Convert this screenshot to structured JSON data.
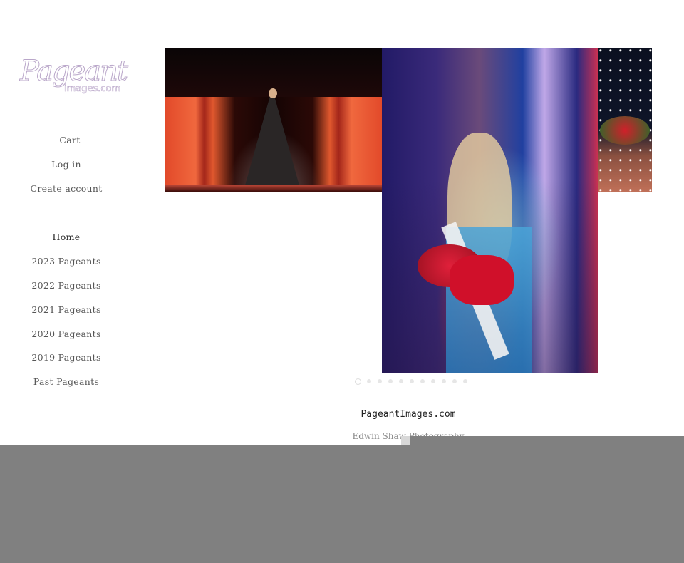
{
  "sidebar": {
    "logo": {
      "line1": "Pageant",
      "line2": "images.com"
    },
    "account_links": [
      {
        "label": "Cart"
      },
      {
        "label": "Log in"
      },
      {
        "label": "Create account"
      }
    ],
    "nav_items": [
      {
        "label": "Home",
        "active": true
      },
      {
        "label": "2023 Pageants"
      },
      {
        "label": "2022 Pageants"
      },
      {
        "label": "2021 Pageants"
      },
      {
        "label": "2020 Pageants"
      },
      {
        "label": "2019 Pageants"
      },
      {
        "label": "Past Pageants"
      }
    ]
  },
  "slideshow": {
    "slides": [
      {
        "alt": "Woman in black gown on red-lit stage"
      },
      {
        "alt": "Newly crowned pageant winner holding roses"
      },
      {
        "alt": "Contestant with bouquet of roses"
      }
    ],
    "dot_count": 11,
    "active_index": 0
  },
  "footer": {
    "title": "PageantImages.com",
    "subtitle": "Edwin Shaw Photography"
  }
}
